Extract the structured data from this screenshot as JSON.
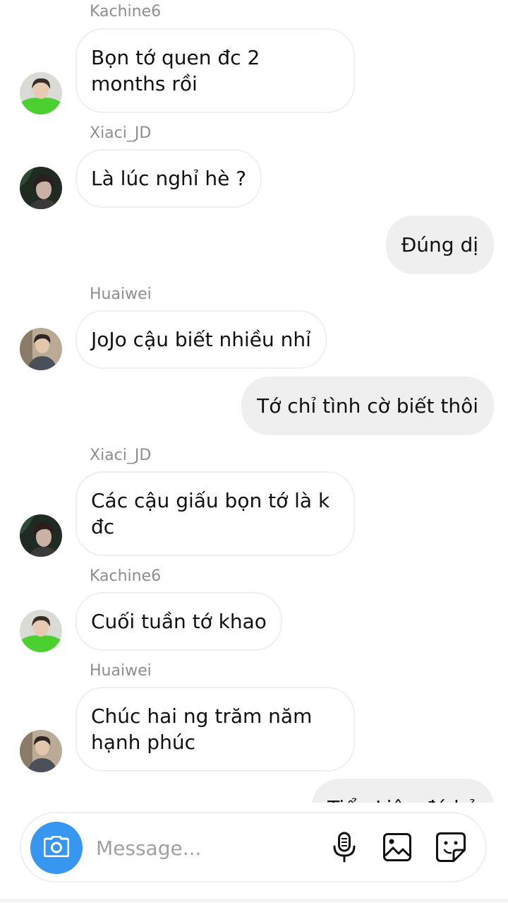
{
  "thread": {
    "messages": [
      {
        "sender": "Kachine6",
        "text": "Bọn tớ quen đc 2 months rồi"
      },
      {
        "sender": "Xiaci_JD",
        "text": "Là lúc nghỉ hè ?"
      },
      {
        "sender": "",
        "text": "Đúng dị"
      },
      {
        "sender": "Huaiwei",
        "text": "JoJo cậu biết nhiều nhỉ"
      },
      {
        "sender": "",
        "text": "Tớ chỉ tình cờ biết thôi"
      },
      {
        "sender": "Xiaci_JD",
        "text": "Các cậu giấu bọn tớ là k đc"
      },
      {
        "sender": "Kachine6",
        "text": "Cuối tuần tớ khao"
      },
      {
        "sender": "Huaiwei",
        "text": "Chúc hai ng trăm năm hạnh phúc"
      },
      {
        "sender": "",
        "text": "Tiểu Liên đó hả"
      }
    ]
  },
  "composer": {
    "placeholder": "Message...",
    "camera_icon": "camera-icon",
    "mic_icon": "microphone-icon",
    "gallery_icon": "image-icon",
    "sticker_icon": "sticker-icon",
    "accent_color": "#3797f0"
  },
  "colors": {
    "outgoing_bubble": "#efefef",
    "incoming_border": "#efefef",
    "sender_label": "#8e8e8e"
  }
}
